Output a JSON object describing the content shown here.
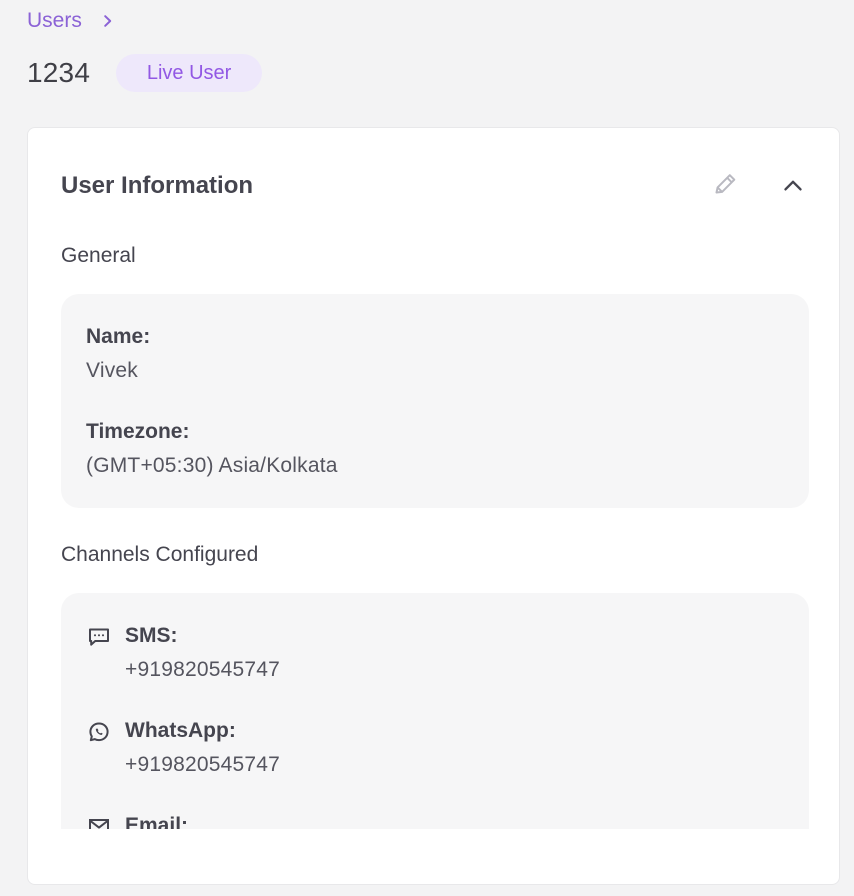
{
  "breadcrumb": {
    "items": [
      {
        "label": "Users",
        "separator_icon": "chevron-right-icon"
      }
    ]
  },
  "page": {
    "title": "1234",
    "status_badge": "Live User"
  },
  "user_information": {
    "title": "User Information",
    "actions": {
      "edit_icon": "pencil-icon",
      "collapse_icon": "chevron-up-icon"
    },
    "general": {
      "heading": "General",
      "fields": [
        {
          "label": "Name:",
          "value": "Vivek"
        },
        {
          "label": "Timezone:",
          "value": "(GMT+05:30) Asia/Kolkata"
        }
      ]
    },
    "channels": {
      "heading": "Channels Configured",
      "items": [
        {
          "icon": "message-icon",
          "label": "SMS:",
          "value": "+919820545747"
        },
        {
          "icon": "whatsapp-icon",
          "label": "WhatsApp:",
          "value": "+919820545747"
        },
        {
          "icon": "mail-icon",
          "label": "Email:"
        }
      ]
    }
  },
  "colors": {
    "accent": "#8b62d6",
    "badge_background": "#eee8fb",
    "badge_text": "#9258e4",
    "page_background": "#f3f3f4",
    "panel_background": "#f6f6f7",
    "text": "#45454f"
  }
}
